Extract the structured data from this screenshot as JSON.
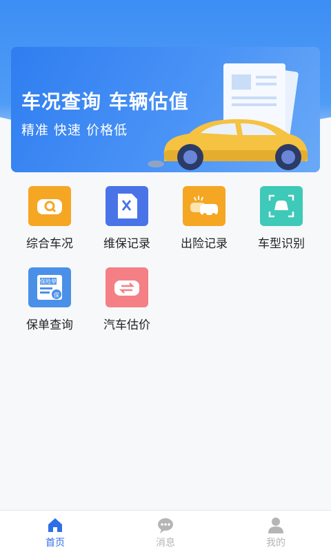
{
  "banner": {
    "title": "车况查询 车辆估值",
    "subtitle": "精准 快速 价格低"
  },
  "services": [
    {
      "label": "综合车况",
      "icon": "car-search-icon",
      "color": "#f5a623"
    },
    {
      "label": "维保记录",
      "icon": "maintenance-icon",
      "color": "#4a73e8"
    },
    {
      "label": "出险记录",
      "icon": "accident-icon",
      "color": "#f5a623"
    },
    {
      "label": "车型识别",
      "icon": "car-scan-icon",
      "color": "#3ec9b8"
    },
    {
      "label": "保单查询",
      "icon": "policy-icon",
      "color": "#4a90e8"
    },
    {
      "label": "汽车估价",
      "icon": "car-valuation-icon",
      "color": "#f47f85"
    }
  ],
  "policy_icon_text": {
    "top": "保险单",
    "badge": "保"
  },
  "tabbar": [
    {
      "label": "首页",
      "icon": "home-icon",
      "active": true
    },
    {
      "label": "消息",
      "icon": "message-icon",
      "active": false
    },
    {
      "label": "我的",
      "icon": "profile-icon",
      "active": false
    }
  ],
  "colors": {
    "primary": "#3d8ef5",
    "active_tab": "#2f6fe6",
    "inactive_tab": "#b5b5b5"
  }
}
